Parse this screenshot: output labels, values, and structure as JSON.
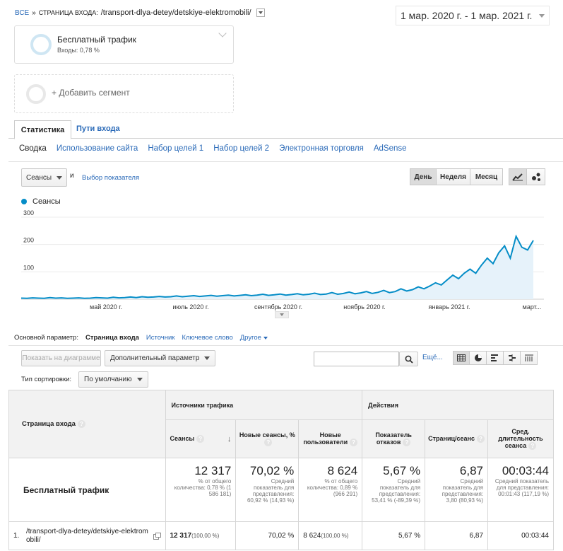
{
  "breadcrumb": {
    "root": "ВСЕ",
    "separator": "»",
    "dimension": "СТРАНИЦА ВХОДА:",
    "path": "/transport-dlya-detey/detskiye-elektromobili/"
  },
  "date_range": "1 мар. 2020 г. - 1 мар. 2021 г.",
  "segments": [
    {
      "title": "Бесплатный трафик",
      "subtitle": "Входы: 0,78 %"
    },
    {
      "title": "+ Добавить сегмент"
    }
  ],
  "tabs": {
    "active": "Статистика",
    "other": "Пути входа"
  },
  "subnav": [
    "Сводка",
    "Использование сайта",
    "Набор целей 1",
    "Набор целей 2",
    "Электронная торговля",
    "AdSense"
  ],
  "metric_select": {
    "value": "Сеансы",
    "and": "и",
    "pick": "Выбор показателя"
  },
  "period_buttons": [
    "День",
    "Неделя",
    "Месяц"
  ],
  "legend": "Сеансы",
  "chart_data": {
    "type": "line",
    "series": [
      {
        "name": "Сеансы",
        "color": "#058dc7",
        "values": [
          4,
          3,
          5,
          4,
          3,
          6,
          4,
          5,
          3,
          4,
          5,
          3,
          4,
          6,
          5,
          4,
          7,
          5,
          6,
          8,
          6,
          9,
          7,
          8,
          10,
          8,
          9,
          12,
          9,
          11,
          13,
          10,
          12,
          14,
          11,
          13,
          15,
          12,
          14,
          16,
          13,
          15,
          18,
          14,
          16,
          19,
          15,
          17,
          20,
          16,
          18,
          22,
          17,
          19,
          24,
          18,
          21,
          26,
          20,
          23,
          28,
          21,
          25,
          32,
          24,
          28,
          38,
          30,
          35,
          45,
          38,
          48,
          60,
          52,
          70,
          88,
          75,
          95,
          110,
          95,
          125,
          150,
          130,
          170,
          195,
          150,
          230,
          190,
          180,
          215
        ]
      }
    ],
    "yticks": [
      "300",
      "200",
      "100"
    ],
    "ylim": [
      0,
      300
    ],
    "xticks": [
      "май 2020 г.",
      "июль 2020 г.",
      "сентябрь 2020 г.",
      "ноябрь 2020 г.",
      "январь 2021 г.",
      "март..."
    ]
  },
  "dimension_bar": {
    "label": "Основной параметр:",
    "active": "Страница входа",
    "items": [
      "Источник",
      "Ключевое слово",
      "Другое"
    ]
  },
  "toolbar": {
    "plot": "Показать на диаграмме",
    "secondary": "Дополнительный параметр",
    "more": "Ещё...",
    "sort_label": "Тип сортировки:",
    "sort_value": "По умолчанию"
  },
  "table": {
    "dim_header": "Страница входа",
    "group_traffic": "Источники трафика",
    "group_actions": "Действия",
    "columns": [
      "Сеансы",
      "Новые сеансы, %",
      "Новые пользователи",
      "Показатель отказов",
      "Страниц/сеанс",
      "Сред. длительность сеанса"
    ],
    "summary_label": "Бесплатный трафик",
    "summary": [
      {
        "value": "12 317",
        "note": "% от общего количества: 0,78 % (1 586 181)"
      },
      {
        "value": "70,02 %",
        "note": "Средний показатель для представления: 60,92 % (14,93 %)"
      },
      {
        "value": "8 624",
        "note": "% от общего количества: 0,89 % (966 291)"
      },
      {
        "value": "5,67 %",
        "note": "Средний показатель для представления: 53,41 % (-89,39 %)"
      },
      {
        "value": "6,87",
        "note": "Средний показатель для представления: 3,80 (80,93 %)"
      },
      {
        "value": "00:03:44",
        "note": "Средний показатель для представления: 00:01:43 (117,19 %)"
      }
    ],
    "row": {
      "index": "1.",
      "page": "/transport-dlya-detey/detskiye-elektromobili/",
      "sessions": "12 317",
      "sessions_pct": "(100,00 %)",
      "new_pct": "70,02 %",
      "new_users": "8 624",
      "new_users_pct": "(100,00 %)",
      "bounce": "5,67 %",
      "pages": "6,87",
      "duration": "00:03:44"
    }
  }
}
